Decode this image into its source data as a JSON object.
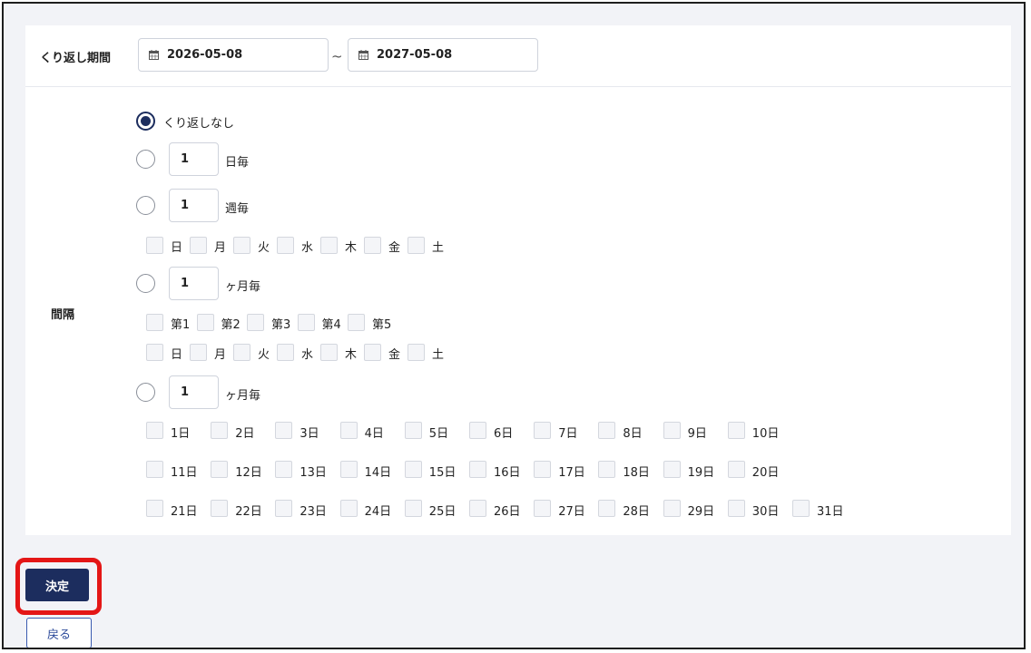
{
  "period": {
    "label": "くり返し期間",
    "start": "2026-05-08",
    "separator": "~",
    "end": "2027-05-08"
  },
  "interval": {
    "label": "間隔",
    "no_repeat_label": "くり返しなし",
    "daily": {
      "value": "1",
      "unit": "日毎"
    },
    "weekly": {
      "value": "1",
      "unit": "週毎"
    },
    "monthly_weekday": {
      "value": "1",
      "unit": "ヶ月毎"
    },
    "monthly_date": {
      "value": "1",
      "unit": "ヶ月毎"
    },
    "weekdays": [
      "日",
      "月",
      "火",
      "水",
      "木",
      "金",
      "土"
    ],
    "weeks": [
      "第1",
      "第2",
      "第3",
      "第4",
      "第5"
    ],
    "dates": [
      "1日",
      "2日",
      "3日",
      "4日",
      "5日",
      "6日",
      "7日",
      "8日",
      "9日",
      "10日",
      "11日",
      "12日",
      "13日",
      "14日",
      "15日",
      "16日",
      "17日",
      "18日",
      "19日",
      "20日",
      "21日",
      "22日",
      "23日",
      "24日",
      "25日",
      "26日",
      "27日",
      "28日",
      "29日",
      "30日",
      "31日"
    ]
  },
  "actions": {
    "confirm_label": "決定",
    "back_label": "戻る"
  },
  "colors": {
    "primary": "#1c2d5e",
    "highlight": "#e41616",
    "background": "#f2f3f7"
  }
}
